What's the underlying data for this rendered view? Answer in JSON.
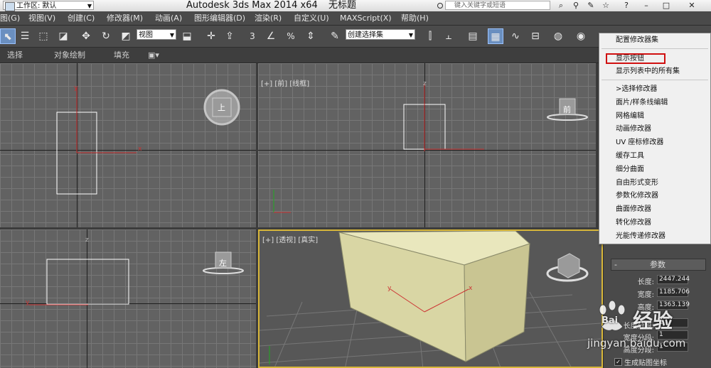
{
  "title_bar": {
    "workspace_label": "工作区: 默认",
    "app_title": "Autodesk 3ds Max  2014 x64",
    "doc_title": "无标题",
    "search_placeholder": "键入关键字或短语"
  },
  "menu": {
    "items": [
      "图(G)",
      "视图(V)",
      "创建(C)",
      "修改器(M)",
      "动画(A)",
      "图形编辑器(D)",
      "渲染(R)",
      "自定义(U)",
      "MAXScript(X)",
      "帮助(H)"
    ]
  },
  "toolbar": {
    "ref_coord_value": "视图",
    "selection_set_value": "创建选择集",
    "angle_snap_label": "3",
    "percent_snap_label": "%"
  },
  "ribbon": {
    "tabs": [
      "选择",
      "对象绘制",
      "填充"
    ]
  },
  "viewports": {
    "perspective_label": "[+] [透视] [真实]",
    "front_label": "[+] [前] [线框]",
    "top_cube_label": "上",
    "front_cube_label": "前",
    "left_cube_label": "左",
    "axis_x": "x",
    "axis_y": "y",
    "axis_z": "z"
  },
  "popup_menu": {
    "items": [
      {
        "label": "配置修改器集"
      },
      {
        "label": "显示按钮",
        "highlighted": true
      },
      {
        "label": "显示列表中的所有集"
      },
      {
        "label": ">选择修改器"
      },
      {
        "label": "面片/样条线编辑"
      },
      {
        "label": "网格编辑"
      },
      {
        "label": "动画修改器"
      },
      {
        "label": "UV 座标修改器"
      },
      {
        "label": "缓存工具"
      },
      {
        "label": "细分曲面"
      },
      {
        "label": "自由形式变形"
      },
      {
        "label": "参数化修改器"
      },
      {
        "label": "曲面修改器"
      },
      {
        "label": "转化修改器"
      },
      {
        "label": "光能传递修改器"
      }
    ],
    "highlight_color": "#d01010"
  },
  "params_panel": {
    "rollout_title": "参数",
    "rollout_toggle": "-",
    "fields": [
      {
        "label": "长度:",
        "value": "2447.244"
      },
      {
        "label": "宽度:",
        "value": "1185.706"
      },
      {
        "label": "高度:",
        "value": "1363.139"
      }
    ],
    "segments": [
      {
        "label": "长度分段:",
        "value": "1"
      },
      {
        "label": "宽度分段:",
        "value": "1"
      },
      {
        "label": "高度分段:",
        "value": "1"
      }
    ],
    "checkbox_label": "生成贴图坐标"
  },
  "watermark": {
    "brand": "Bai",
    "brand_cn": "经验",
    "url": "jingyan.baidu.com"
  }
}
